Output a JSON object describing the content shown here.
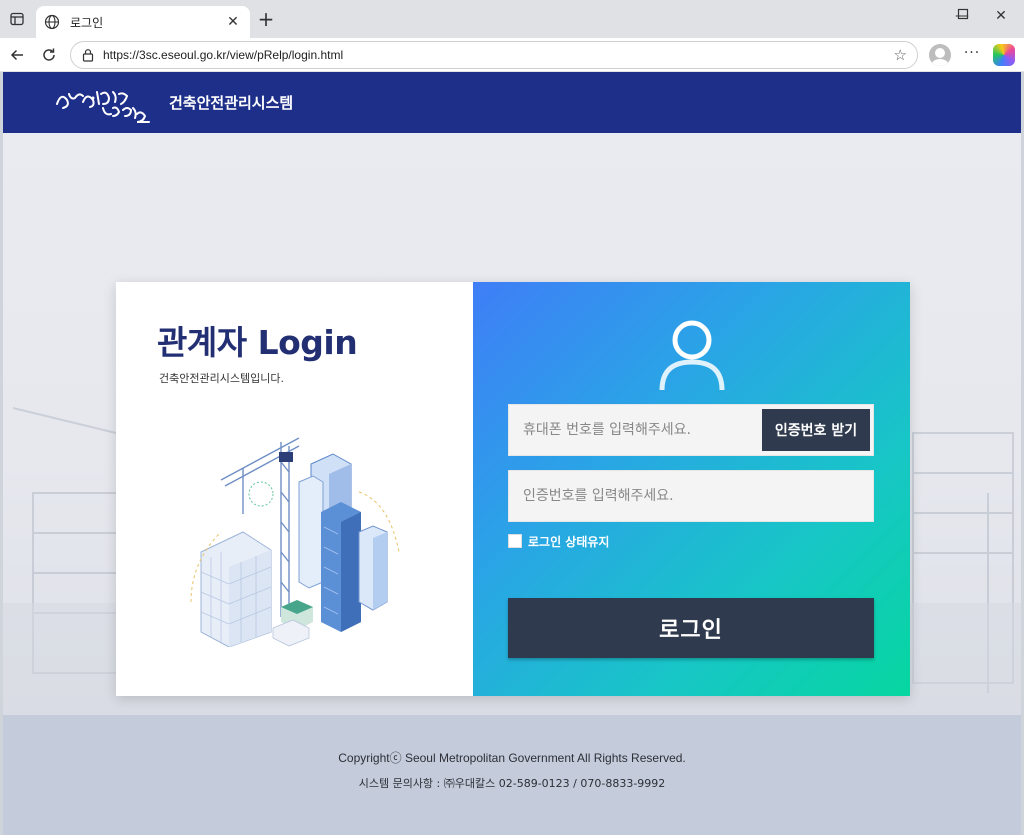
{
  "browser": {
    "tab_title": "로그인",
    "url": "https://3sc.eseoul.go.kr/view/pRelp/login.html"
  },
  "header": {
    "logo_alt": "동행·매력 특별시 서울",
    "site_title": "건축안전관리시스템"
  },
  "login": {
    "heading": "관계자 Login",
    "subheading": "건축안전관리시스템입니다.",
    "phone_placeholder": "휴대폰 번호를 입력해주세요.",
    "otp_button": "인증번호 받기",
    "code_placeholder": "인증번호를 입력해주세요.",
    "keep_login_label": "로그인 상태유지",
    "keep_login_checked": false,
    "login_button": "로그인"
  },
  "footer": {
    "copyright": "Copyrightⓒ Seoul Metropolitan Government All Rights Reserved.",
    "contact": "시스템 문의사항 : ㈜우대칼스 02-589-0123 / 070-8833-9992"
  },
  "icons": {
    "tab_actions": "tab-actions-icon",
    "site": "globe-icon",
    "tab_close": "close-icon",
    "new_tab": "plus-icon",
    "minimize": "minimize-icon",
    "maximize": "maximize-icon",
    "close_window": "close-icon",
    "back": "back-arrow-icon",
    "refresh": "refresh-icon",
    "security": "lock-icon",
    "favorite": "star-icon",
    "profile": "profile-icon",
    "menu": "more-icon",
    "copilot": "copilot-icon",
    "user": "user-icon"
  },
  "colors": {
    "header_bg": "#1e2f8a",
    "heading_text": "#232f73",
    "panel_gradient_start": "#3f7ef7",
    "panel_gradient_end": "#06d6a0",
    "button_bg": "#2f3a4f",
    "footer_bg": "#c4ccdc"
  }
}
